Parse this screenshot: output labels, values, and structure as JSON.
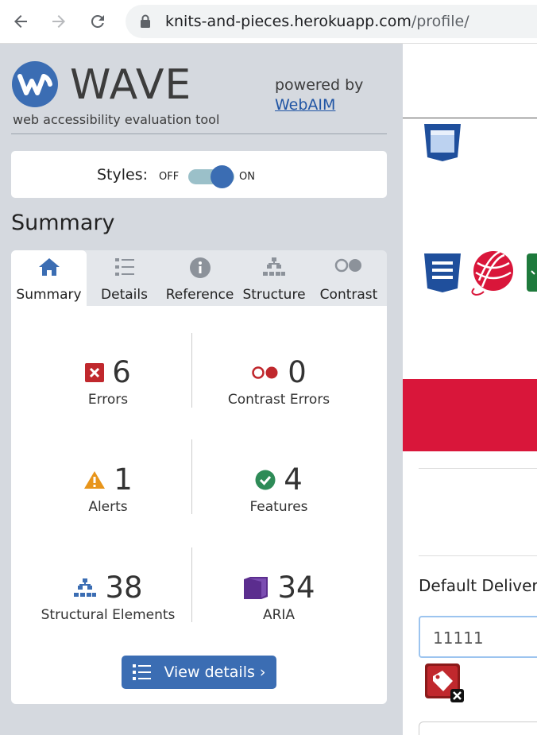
{
  "browser": {
    "url_host": "knits-and-pieces.herokuapp.com",
    "url_path": "/profile/",
    "back_icon": "arrow-left-icon",
    "forward_icon": "arrow-right-icon",
    "reload_icon": "reload-icon",
    "lock_icon": "lock-icon"
  },
  "wave": {
    "title": "WAVE",
    "subtitle": "web accessibility evaluation tool",
    "powered_by": "powered by",
    "powered_link": "WebAIM",
    "styles_label": "Styles:",
    "styles_off": "OFF",
    "styles_on": "ON",
    "styles_state": "on",
    "summary_heading": "Summary",
    "tabs": [
      {
        "label": "Summary",
        "icon": "home-icon",
        "active": true
      },
      {
        "label": "Details",
        "icon": "list-icon",
        "active": false
      },
      {
        "label": "Reference",
        "icon": "info-icon",
        "active": false
      },
      {
        "label": "Structure",
        "icon": "structure-icon",
        "active": false
      },
      {
        "label": "Contrast",
        "icon": "contrast-icon",
        "active": false
      }
    ],
    "stats": [
      {
        "count": "6",
        "label": "Errors",
        "icon": "error-icon"
      },
      {
        "count": "0",
        "label": "Contrast Errors",
        "icon": "contrast-error-icon"
      },
      {
        "count": "1",
        "label": "Alerts",
        "icon": "alert-icon"
      },
      {
        "count": "4",
        "label": "Features",
        "icon": "feature-icon"
      },
      {
        "count": "38",
        "label": "Structural Elements",
        "icon": "structure-icon"
      },
      {
        "count": "34",
        "label": "ARIA",
        "icon": "aria-icon"
      }
    ],
    "view_details_label": "View details ›",
    "colors": {
      "sidebar_bg": "#d5d9df",
      "primary": "#3b6db3",
      "error": "#c0282d",
      "alert": "#e8951b",
      "feature": "#2e8b57",
      "aria": "#5b2d8e"
    }
  },
  "page": {
    "field_label": "Default Delivery",
    "field_value": "11111",
    "banner_color": "#d9163a"
  }
}
